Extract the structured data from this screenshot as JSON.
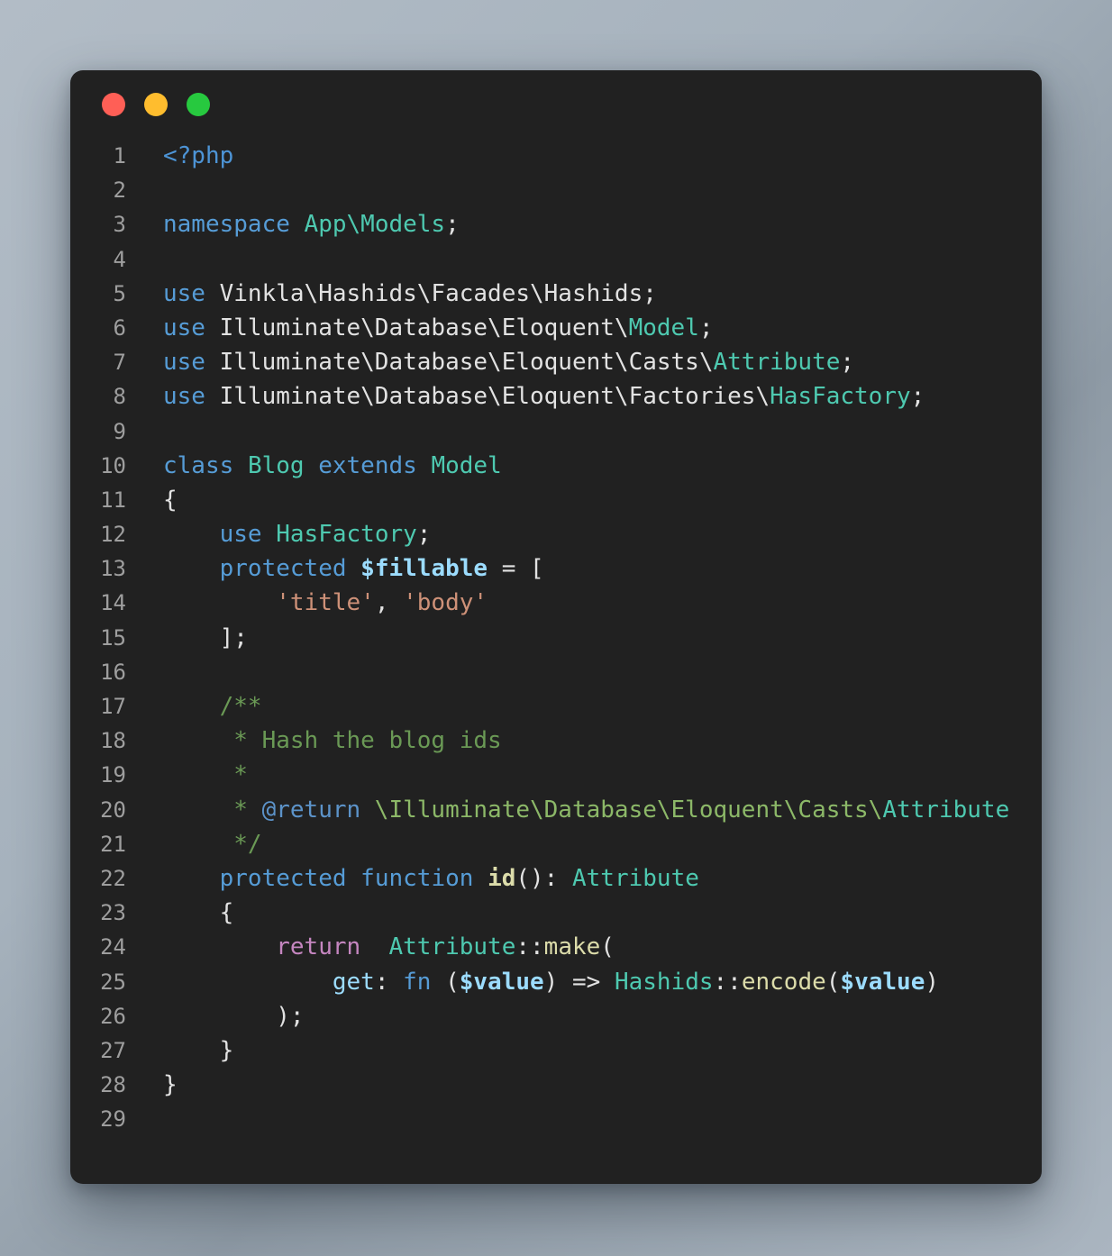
{
  "window": {
    "background_color": "#212121",
    "page_gradient_from": "#b2bcc6",
    "page_gradient_to": "#8e9aa5",
    "traffic_lights": [
      {
        "name": "close",
        "color": "#ff5f56"
      },
      {
        "name": "minimize",
        "color": "#ffbd2e"
      },
      {
        "name": "maximize",
        "color": "#27c93f"
      }
    ]
  },
  "editor": {
    "language": "php",
    "first_line": 1,
    "last_line": 29,
    "line_numbers": [
      "1",
      "2",
      "3",
      "4",
      "5",
      "6",
      "7",
      "8",
      "9",
      "10",
      "11",
      "12",
      "13",
      "14",
      "15",
      "16",
      "17",
      "18",
      "19",
      "20",
      "21",
      "22",
      "23",
      "24",
      "25",
      "26",
      "27",
      "28",
      "29"
    ],
    "plain_text": "<?php\n\nnamespace App\\Models;\n\nuse Vinkla\\Hashids\\Facades\\Hashids;\nuse Illuminate\\Database\\Eloquent\\Model;\nuse Illuminate\\Database\\Eloquent\\Casts\\Attribute;\nuse Illuminate\\Database\\Eloquent\\Factories\\HasFactory;\n\nclass Blog extends Model\n{\n    use HasFactory;\n    protected $fillable = [\n        'title', 'body'\n    ];\n\n    /**\n     * Hash the blog ids\n     *\n     * @return \\Illuminate\\Database\\Eloquent\\Casts\\Attribute\n     */\n    protected function id(): Attribute\n    {\n        return  Attribute::make(\n            get: fn ($value) => Hashids::encode($value)\n        );\n    }\n}\n",
    "lines": [
      {
        "n": "1",
        "tokens": [
          {
            "t": "<?php",
            "c": "t-php"
          }
        ]
      },
      {
        "n": "2",
        "tokens": []
      },
      {
        "n": "3",
        "tokens": [
          {
            "t": "namespace",
            "c": "t-kw"
          },
          {
            "t": " ",
            "c": "t-plain"
          },
          {
            "t": "App\\Models",
            "c": "t-type"
          },
          {
            "t": ";",
            "c": "t-plain"
          }
        ]
      },
      {
        "n": "4",
        "tokens": []
      },
      {
        "n": "5",
        "tokens": [
          {
            "t": "use",
            "c": "t-kw"
          },
          {
            "t": " Vinkla\\Hashids\\Facades\\Hashids;",
            "c": "t-plain"
          }
        ]
      },
      {
        "n": "6",
        "tokens": [
          {
            "t": "use",
            "c": "t-kw"
          },
          {
            "t": " Illuminate\\Database\\Eloquent\\",
            "c": "t-plain"
          },
          {
            "t": "Model",
            "c": "t-type"
          },
          {
            "t": ";",
            "c": "t-plain"
          }
        ]
      },
      {
        "n": "7",
        "tokens": [
          {
            "t": "use",
            "c": "t-kw"
          },
          {
            "t": " Illuminate\\Database\\Eloquent\\Casts\\",
            "c": "t-plain"
          },
          {
            "t": "Attribute",
            "c": "t-type"
          },
          {
            "t": ";",
            "c": "t-plain"
          }
        ]
      },
      {
        "n": "8",
        "tokens": [
          {
            "t": "use",
            "c": "t-kw"
          },
          {
            "t": " Illuminate\\Database\\Eloquent\\Factories\\",
            "c": "t-plain"
          },
          {
            "t": "HasFactory",
            "c": "t-type"
          },
          {
            "t": ";",
            "c": "t-plain"
          }
        ]
      },
      {
        "n": "9",
        "tokens": []
      },
      {
        "n": "10",
        "tokens": [
          {
            "t": "class",
            "c": "t-kw"
          },
          {
            "t": " ",
            "c": "t-plain"
          },
          {
            "t": "Blog",
            "c": "t-type"
          },
          {
            "t": " ",
            "c": "t-plain"
          },
          {
            "t": "extends",
            "c": "t-kw"
          },
          {
            "t": " ",
            "c": "t-plain"
          },
          {
            "t": "Model",
            "c": "t-type"
          }
        ]
      },
      {
        "n": "11",
        "tokens": [
          {
            "t": "{",
            "c": "t-plain"
          }
        ]
      },
      {
        "n": "12",
        "tokens": [
          {
            "t": "    ",
            "c": "t-plain"
          },
          {
            "t": "use",
            "c": "t-kw"
          },
          {
            "t": " ",
            "c": "t-plain"
          },
          {
            "t": "HasFactory",
            "c": "t-type"
          },
          {
            "t": ";",
            "c": "t-plain"
          }
        ]
      },
      {
        "n": "13",
        "tokens": [
          {
            "t": "    ",
            "c": "t-plain"
          },
          {
            "t": "protected",
            "c": "t-kw"
          },
          {
            "t": " ",
            "c": "t-plain"
          },
          {
            "t": "$fillable",
            "c": "t-var bold"
          },
          {
            "t": " = [",
            "c": "t-plain"
          }
        ]
      },
      {
        "n": "14",
        "tokens": [
          {
            "t": "        ",
            "c": "t-plain"
          },
          {
            "t": "'title'",
            "c": "t-str"
          },
          {
            "t": ", ",
            "c": "t-plain"
          },
          {
            "t": "'body'",
            "c": "t-str"
          }
        ]
      },
      {
        "n": "15",
        "tokens": [
          {
            "t": "    ];",
            "c": "t-plain"
          }
        ]
      },
      {
        "n": "16",
        "tokens": []
      },
      {
        "n": "17",
        "tokens": [
          {
            "t": "    ",
            "c": "t-plain"
          },
          {
            "t": "/**",
            "c": "t-cmt"
          }
        ]
      },
      {
        "n": "18",
        "tokens": [
          {
            "t": "     * Hash the blog ids",
            "c": "t-cmt"
          }
        ]
      },
      {
        "n": "19",
        "tokens": [
          {
            "t": "     *",
            "c": "t-cmt"
          }
        ]
      },
      {
        "n": "20",
        "tokens": [
          {
            "t": "     * ",
            "c": "t-cmt"
          },
          {
            "t": "@return",
            "c": "t-cmt-tag"
          },
          {
            "t": " \\Illuminate\\Database\\Eloquent\\Casts\\",
            "c": "t-cmt-path"
          },
          {
            "t": "Attribute",
            "c": "t-cmt-type"
          }
        ]
      },
      {
        "n": "21",
        "tokens": [
          {
            "t": "     */",
            "c": "t-cmt"
          }
        ]
      },
      {
        "n": "22",
        "tokens": [
          {
            "t": "    ",
            "c": "t-plain"
          },
          {
            "t": "protected",
            "c": "t-kw"
          },
          {
            "t": " ",
            "c": "t-plain"
          },
          {
            "t": "function",
            "c": "t-kw"
          },
          {
            "t": " ",
            "c": "t-plain"
          },
          {
            "t": "id",
            "c": "t-fn bold"
          },
          {
            "t": "(): ",
            "c": "t-plain"
          },
          {
            "t": "Attribute",
            "c": "t-type"
          }
        ]
      },
      {
        "n": "23",
        "tokens": [
          {
            "t": "    {",
            "c": "t-plain"
          }
        ]
      },
      {
        "n": "24",
        "tokens": [
          {
            "t": "        ",
            "c": "t-plain"
          },
          {
            "t": "return",
            "c": "t-ctrl"
          },
          {
            "t": "  ",
            "c": "t-plain"
          },
          {
            "t": "Attribute",
            "c": "t-type"
          },
          {
            "t": "::",
            "c": "t-plain"
          },
          {
            "t": "make",
            "c": "t-fn"
          },
          {
            "t": "(",
            "c": "t-plain"
          }
        ]
      },
      {
        "n": "25",
        "tokens": [
          {
            "t": "            ",
            "c": "t-plain"
          },
          {
            "t": "get",
            "c": "t-var"
          },
          {
            "t": ": ",
            "c": "t-plain"
          },
          {
            "t": "fn",
            "c": "t-kw"
          },
          {
            "t": " (",
            "c": "t-plain"
          },
          {
            "t": "$value",
            "c": "t-var bold"
          },
          {
            "t": ") => ",
            "c": "t-plain"
          },
          {
            "t": "Hashids",
            "c": "t-type"
          },
          {
            "t": "::",
            "c": "t-plain"
          },
          {
            "t": "encode",
            "c": "t-fn"
          },
          {
            "t": "(",
            "c": "t-plain"
          },
          {
            "t": "$value",
            "c": "t-var bold"
          },
          {
            "t": ")",
            "c": "t-plain"
          }
        ]
      },
      {
        "n": "26",
        "tokens": [
          {
            "t": "        );",
            "c": "t-plain"
          }
        ]
      },
      {
        "n": "27",
        "tokens": [
          {
            "t": "    }",
            "c": "t-plain"
          }
        ]
      },
      {
        "n": "28",
        "tokens": [
          {
            "t": "}",
            "c": "t-plain"
          }
        ]
      },
      {
        "n": "29",
        "tokens": []
      }
    ]
  }
}
